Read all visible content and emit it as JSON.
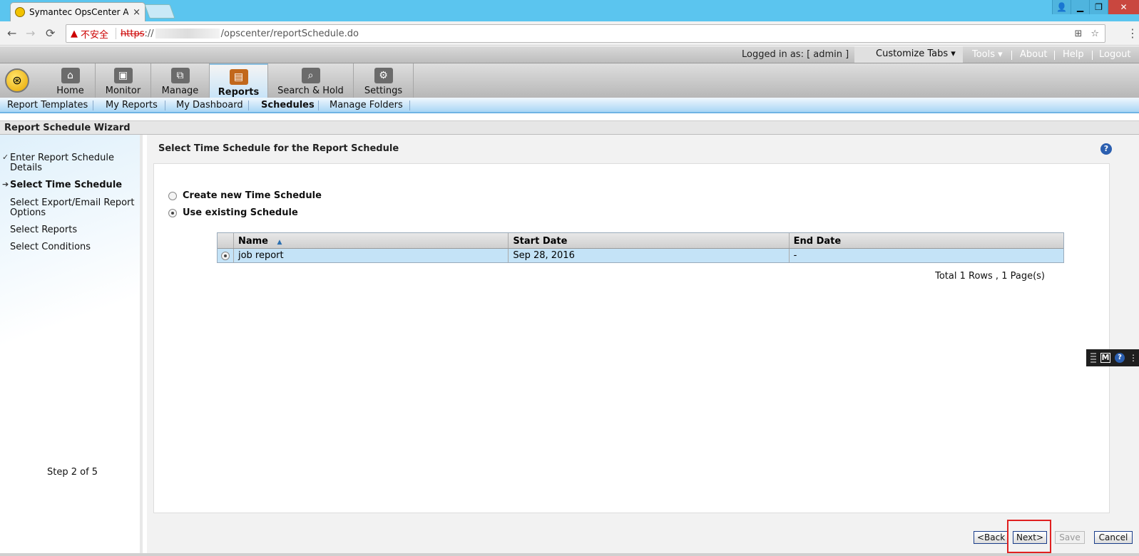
{
  "browser": {
    "tab_title": "Symantec OpsCenter A",
    "tab_close": "×",
    "nav": {
      "back": "←",
      "forward": "→",
      "reload": "⟳"
    },
    "address": {
      "warning_icon": "▲",
      "insecure_label": "不安全",
      "scheme": "https",
      "scheme_sep": "://",
      "path": "/opscenter/reportSchedule.do"
    },
    "omni_icons": {
      "translate": "⊞",
      "star": "☆",
      "menu": "⋮"
    },
    "window": {
      "user": "👤",
      "minimize": "▁",
      "restore": "❐",
      "close": "✕"
    }
  },
  "header": {
    "logged_in": "Logged in as: [ admin ]",
    "customize_tabs": "Customize Tabs ▾",
    "links": [
      "Tools ▾",
      "About",
      "Help",
      "Logout"
    ]
  },
  "main_tabs": [
    {
      "label": "Home",
      "icon": "⌂"
    },
    {
      "label": "Monitor",
      "icon": "▣"
    },
    {
      "label": "Manage",
      "icon": "⧉"
    },
    {
      "label": "Reports",
      "icon": "▤"
    },
    {
      "label": "Search & Hold",
      "icon": "⌕"
    },
    {
      "label": "Settings",
      "icon": "⚙"
    }
  ],
  "logo_icon": "⊛",
  "sub_tabs": [
    "Report Templates",
    "My Reports",
    "My Dashboard",
    "Schedules",
    "Manage Folders"
  ],
  "wizard": {
    "header": "Report Schedule Wizard",
    "steps": [
      {
        "label": "Enter Report Schedule Details",
        "mark": "✓"
      },
      {
        "label": "Select Time Schedule",
        "mark": "➔"
      },
      {
        "label": "Select Export/Email Report Options",
        "mark": ""
      },
      {
        "label": "Select Reports",
        "mark": ""
      },
      {
        "label": "Select Conditions",
        "mark": ""
      }
    ],
    "step_count": "Step 2 of 5"
  },
  "content": {
    "title": "Select Time Schedule for the Report Schedule",
    "help": "?",
    "options": [
      {
        "label": "Create new Time Schedule",
        "checked": false
      },
      {
        "label": "Use existing Schedule",
        "checked": true
      }
    ],
    "table": {
      "columns": [
        "Name",
        "Start Date",
        "End Date"
      ],
      "sort_icon": "▲",
      "rows": [
        {
          "name": "job report",
          "start": "Sep 28, 2016",
          "end": "-"
        }
      ],
      "total": "Total 1 Rows , 1 Page(s)"
    }
  },
  "floating": {
    "m": "M",
    "q": "?",
    "more": "⋮"
  },
  "buttons": {
    "back": "<Back",
    "next": "Next>",
    "save": "Save",
    "cancel": "Cancel"
  }
}
